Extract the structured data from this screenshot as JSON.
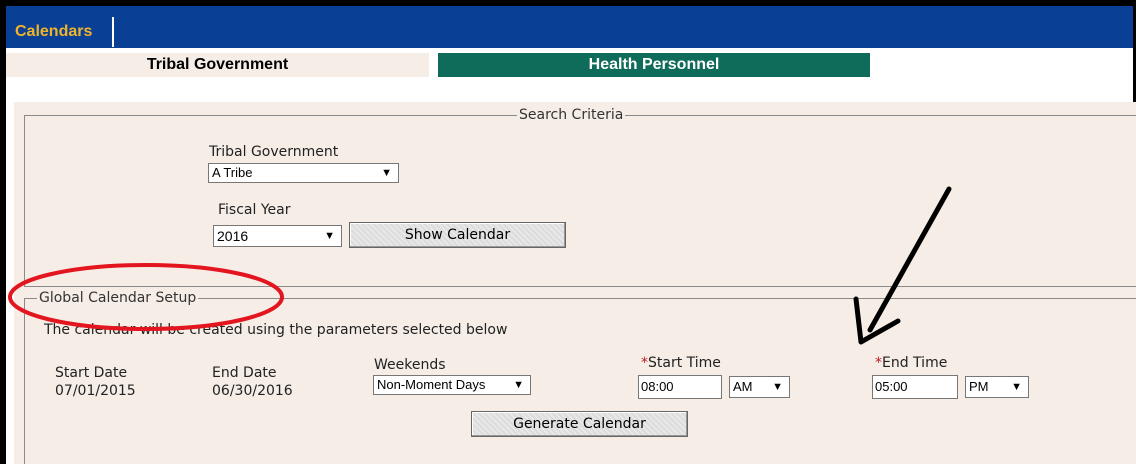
{
  "header": {
    "calendars_tab": "Calendars"
  },
  "tabs": [
    {
      "label": "Tribal Government",
      "active": true
    },
    {
      "label": "Health Personnel",
      "active": false
    }
  ],
  "search_criteria": {
    "legend": "Search Criteria",
    "tribal_government_label": "Tribal Government",
    "tribal_government_value": "A Tribe",
    "fiscal_year_label": "Fiscal Year",
    "fiscal_year_value": "2016",
    "show_calendar_button": "Show Calendar"
  },
  "global_setup": {
    "legend": "Global Calendar Setup",
    "info_text": "The calendar will be created using the parameters selected below",
    "start_date_label": "Start Date",
    "start_date_value": "07/01/2015",
    "end_date_label": "End Date",
    "end_date_value": "06/30/2016",
    "weekends_label": "Weekends",
    "weekends_value": "Non-Moment Days",
    "required_marker": "*",
    "start_time_label": "Start Time",
    "start_time_value": "08:00",
    "start_ampm": "AM",
    "end_time_label": "End Time",
    "end_time_value": "05:00",
    "end_ampm": "PM",
    "generate_button": "Generate Calendar"
  },
  "colors": {
    "header_blue": "#0a3f96",
    "header_text": "#f0b429",
    "tab_green": "#0f6b5a",
    "panel_bg": "#f5ede6",
    "annotation_red": "#e3151f",
    "required_red": "#c0191f"
  }
}
